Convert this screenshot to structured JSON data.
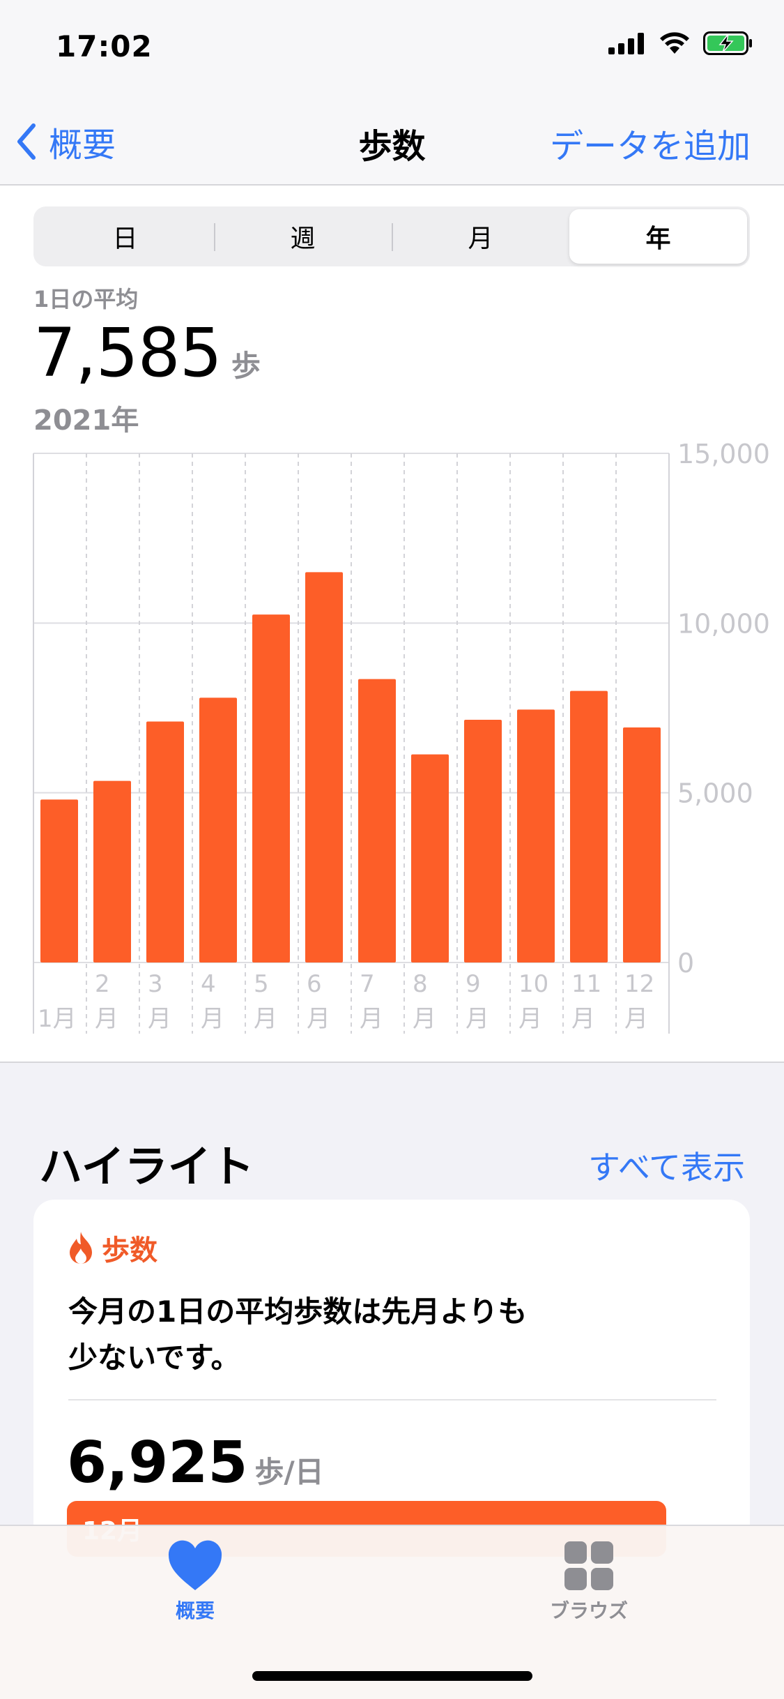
{
  "status_bar": {
    "time": "17:02",
    "icons": [
      "signal-icon",
      "wifi-icon",
      "battery-charging-icon"
    ],
    "battery_color": "#34c759"
  },
  "nav": {
    "back_label": "概要",
    "title": "歩数",
    "action_label": "データを追加",
    "accent_color": "#3478f6"
  },
  "segments": {
    "items": [
      "日",
      "週",
      "月",
      "年"
    ],
    "selected": "年"
  },
  "summary": {
    "label": "1日の平均",
    "value": "7,585",
    "unit": "歩",
    "period": "2021年"
  },
  "chart_data": {
    "type": "bar",
    "categories": [
      "1月",
      "2月",
      "3月",
      "4月",
      "5月",
      "6月",
      "7月",
      "8月",
      "9月",
      "10月",
      "11月",
      "12月"
    ],
    "tick_labels": [
      [
        "1月"
      ],
      [
        "2",
        "月"
      ],
      [
        "3",
        "月"
      ],
      [
        "4",
        "月"
      ],
      [
        "5",
        "月"
      ],
      [
        "6",
        "月"
      ],
      [
        "7",
        "月"
      ],
      [
        "8",
        "月"
      ],
      [
        "9",
        "月"
      ],
      [
        "10",
        "月"
      ],
      [
        "11",
        "月"
      ],
      [
        "12",
        "月"
      ]
    ],
    "values": [
      4800,
      5350,
      7100,
      7800,
      10250,
      11500,
      8350,
      6130,
      7150,
      7450,
      8000,
      6925
    ],
    "ylim": [
      0,
      15000
    ],
    "yticks": [
      0,
      5000,
      10000,
      15000
    ],
    "ytick_labels": [
      "0",
      "5,000",
      "10,000",
      "15,000"
    ],
    "bar_color": "#fd5e28",
    "grid": true,
    "y_axis_position": "right"
  },
  "highlights": {
    "title": "ハイライト",
    "show_all_label": "すべて表示",
    "card": {
      "category": "歩数",
      "category_color": "#f05a28",
      "line1": "今月の1日の平均歩数は先月よりも",
      "line2": "少ないです。",
      "value": "6,925",
      "unit": "歩/日",
      "bar_label": "12月"
    }
  },
  "tab_bar": {
    "tabs": [
      {
        "label": "概要",
        "icon": "heart-icon",
        "active": true
      },
      {
        "label": "ブラウズ",
        "icon": "grid-icon",
        "active": false
      }
    ]
  }
}
